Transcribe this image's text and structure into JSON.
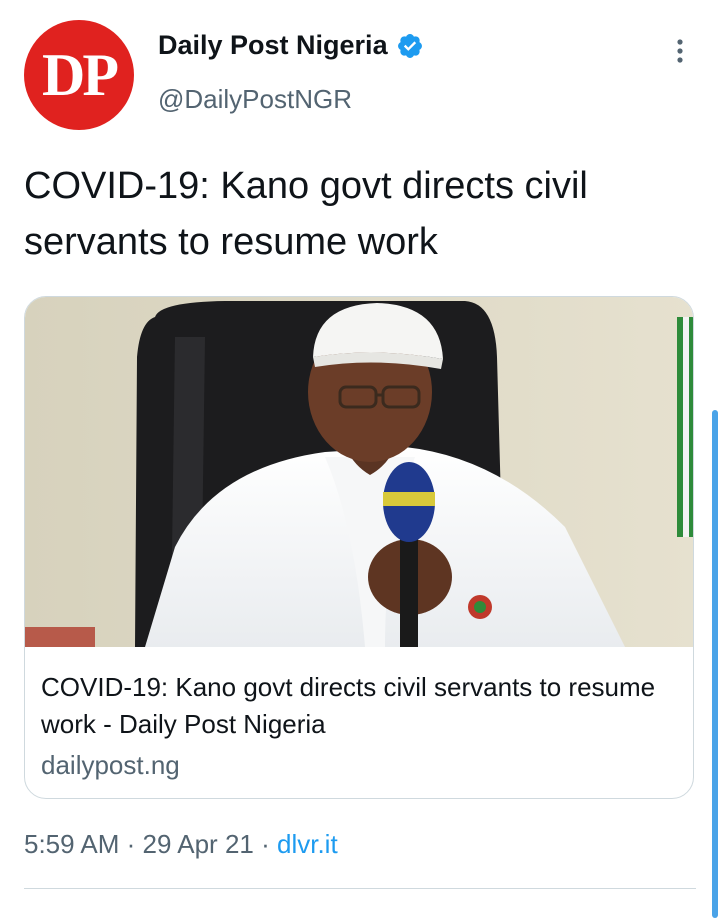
{
  "author": {
    "display_name": "Daily Post Nigeria",
    "handle": "@DailyPostNGR",
    "avatar_text": "DP",
    "avatar_color": "#e0221f",
    "verified": true,
    "verified_icon": "verified-badge-icon"
  },
  "tweet": {
    "text": "COVID-19: Kano govt directs civil servants to resume work"
  },
  "link_card": {
    "title": "COVID-19: Kano govt directs civil servants to resume work - Daily Post Nigeria",
    "domain": "dailypost.ng",
    "image": "photo-man-with-microphone"
  },
  "meta": {
    "time": "5:59 AM",
    "separator": "·",
    "date": "29 Apr 21",
    "source": "dlvr.it"
  },
  "colors": {
    "accent": "#1d9bf0",
    "secondary_text": "#536471"
  }
}
